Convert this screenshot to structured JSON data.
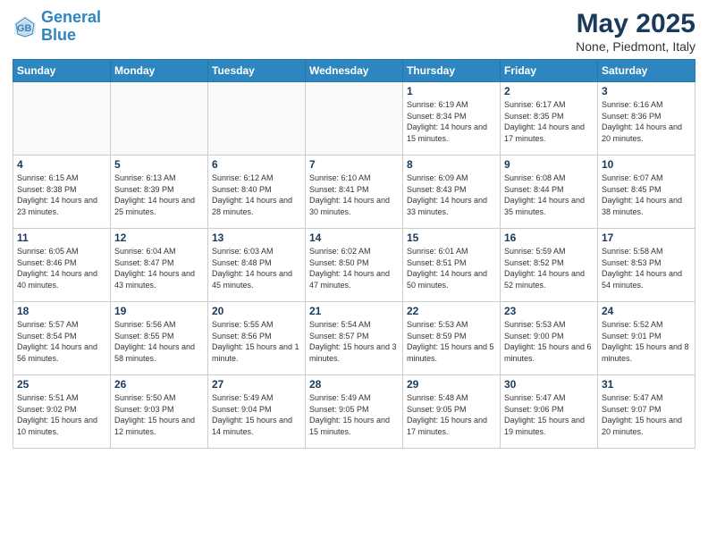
{
  "header": {
    "logo_line1": "General",
    "logo_line2": "Blue",
    "title": "May 2025",
    "subtitle": "None, Piedmont, Italy"
  },
  "weekdays": [
    "Sunday",
    "Monday",
    "Tuesday",
    "Wednesday",
    "Thursday",
    "Friday",
    "Saturday"
  ],
  "weeks": [
    [
      {
        "day": "",
        "info": ""
      },
      {
        "day": "",
        "info": ""
      },
      {
        "day": "",
        "info": ""
      },
      {
        "day": "",
        "info": ""
      },
      {
        "day": "1",
        "info": "Sunrise: 6:19 AM\nSunset: 8:34 PM\nDaylight: 14 hours\nand 15 minutes."
      },
      {
        "day": "2",
        "info": "Sunrise: 6:17 AM\nSunset: 8:35 PM\nDaylight: 14 hours\nand 17 minutes."
      },
      {
        "day": "3",
        "info": "Sunrise: 6:16 AM\nSunset: 8:36 PM\nDaylight: 14 hours\nand 20 minutes."
      }
    ],
    [
      {
        "day": "4",
        "info": "Sunrise: 6:15 AM\nSunset: 8:38 PM\nDaylight: 14 hours\nand 23 minutes."
      },
      {
        "day": "5",
        "info": "Sunrise: 6:13 AM\nSunset: 8:39 PM\nDaylight: 14 hours\nand 25 minutes."
      },
      {
        "day": "6",
        "info": "Sunrise: 6:12 AM\nSunset: 8:40 PM\nDaylight: 14 hours\nand 28 minutes."
      },
      {
        "day": "7",
        "info": "Sunrise: 6:10 AM\nSunset: 8:41 PM\nDaylight: 14 hours\nand 30 minutes."
      },
      {
        "day": "8",
        "info": "Sunrise: 6:09 AM\nSunset: 8:43 PM\nDaylight: 14 hours\nand 33 minutes."
      },
      {
        "day": "9",
        "info": "Sunrise: 6:08 AM\nSunset: 8:44 PM\nDaylight: 14 hours\nand 35 minutes."
      },
      {
        "day": "10",
        "info": "Sunrise: 6:07 AM\nSunset: 8:45 PM\nDaylight: 14 hours\nand 38 minutes."
      }
    ],
    [
      {
        "day": "11",
        "info": "Sunrise: 6:05 AM\nSunset: 8:46 PM\nDaylight: 14 hours\nand 40 minutes."
      },
      {
        "day": "12",
        "info": "Sunrise: 6:04 AM\nSunset: 8:47 PM\nDaylight: 14 hours\nand 43 minutes."
      },
      {
        "day": "13",
        "info": "Sunrise: 6:03 AM\nSunset: 8:48 PM\nDaylight: 14 hours\nand 45 minutes."
      },
      {
        "day": "14",
        "info": "Sunrise: 6:02 AM\nSunset: 8:50 PM\nDaylight: 14 hours\nand 47 minutes."
      },
      {
        "day": "15",
        "info": "Sunrise: 6:01 AM\nSunset: 8:51 PM\nDaylight: 14 hours\nand 50 minutes."
      },
      {
        "day": "16",
        "info": "Sunrise: 5:59 AM\nSunset: 8:52 PM\nDaylight: 14 hours\nand 52 minutes."
      },
      {
        "day": "17",
        "info": "Sunrise: 5:58 AM\nSunset: 8:53 PM\nDaylight: 14 hours\nand 54 minutes."
      }
    ],
    [
      {
        "day": "18",
        "info": "Sunrise: 5:57 AM\nSunset: 8:54 PM\nDaylight: 14 hours\nand 56 minutes."
      },
      {
        "day": "19",
        "info": "Sunrise: 5:56 AM\nSunset: 8:55 PM\nDaylight: 14 hours\nand 58 minutes."
      },
      {
        "day": "20",
        "info": "Sunrise: 5:55 AM\nSunset: 8:56 PM\nDaylight: 15 hours\nand 1 minute."
      },
      {
        "day": "21",
        "info": "Sunrise: 5:54 AM\nSunset: 8:57 PM\nDaylight: 15 hours\nand 3 minutes."
      },
      {
        "day": "22",
        "info": "Sunrise: 5:53 AM\nSunset: 8:59 PM\nDaylight: 15 hours\nand 5 minutes."
      },
      {
        "day": "23",
        "info": "Sunrise: 5:53 AM\nSunset: 9:00 PM\nDaylight: 15 hours\nand 6 minutes."
      },
      {
        "day": "24",
        "info": "Sunrise: 5:52 AM\nSunset: 9:01 PM\nDaylight: 15 hours\nand 8 minutes."
      }
    ],
    [
      {
        "day": "25",
        "info": "Sunrise: 5:51 AM\nSunset: 9:02 PM\nDaylight: 15 hours\nand 10 minutes."
      },
      {
        "day": "26",
        "info": "Sunrise: 5:50 AM\nSunset: 9:03 PM\nDaylight: 15 hours\nand 12 minutes."
      },
      {
        "day": "27",
        "info": "Sunrise: 5:49 AM\nSunset: 9:04 PM\nDaylight: 15 hours\nand 14 minutes."
      },
      {
        "day": "28",
        "info": "Sunrise: 5:49 AM\nSunset: 9:05 PM\nDaylight: 15 hours\nand 15 minutes."
      },
      {
        "day": "29",
        "info": "Sunrise: 5:48 AM\nSunset: 9:05 PM\nDaylight: 15 hours\nand 17 minutes."
      },
      {
        "day": "30",
        "info": "Sunrise: 5:47 AM\nSunset: 9:06 PM\nDaylight: 15 hours\nand 19 minutes."
      },
      {
        "day": "31",
        "info": "Sunrise: 5:47 AM\nSunset: 9:07 PM\nDaylight: 15 hours\nand 20 minutes."
      }
    ]
  ]
}
